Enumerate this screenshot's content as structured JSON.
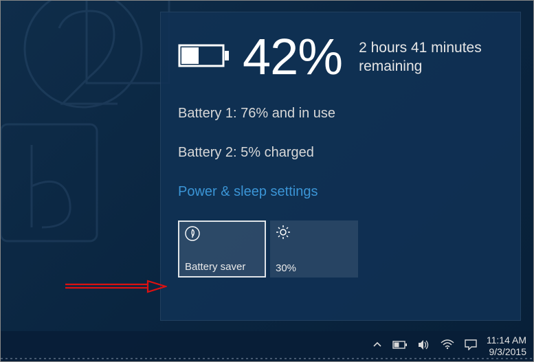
{
  "flyout": {
    "percent": "42%",
    "remaining": "2 hours 41 minutes remaining",
    "battery1": "Battery 1: 76% and in use",
    "battery2": "Battery 2: 5% charged",
    "link": "Power & sleep settings",
    "tiles": {
      "saver": {
        "label": "Battery saver"
      },
      "brightness": {
        "label": "30%"
      }
    }
  },
  "taskbar": {
    "time": "11:14 AM",
    "date": "9/3/2015"
  },
  "icons": {
    "battery": "battery-icon",
    "leaf": "leaf-icon",
    "brightness": "brightness-icon",
    "chevron": "chevron-up-icon",
    "volume": "volume-icon",
    "wifi": "wifi-icon",
    "action": "action-center-icon"
  }
}
